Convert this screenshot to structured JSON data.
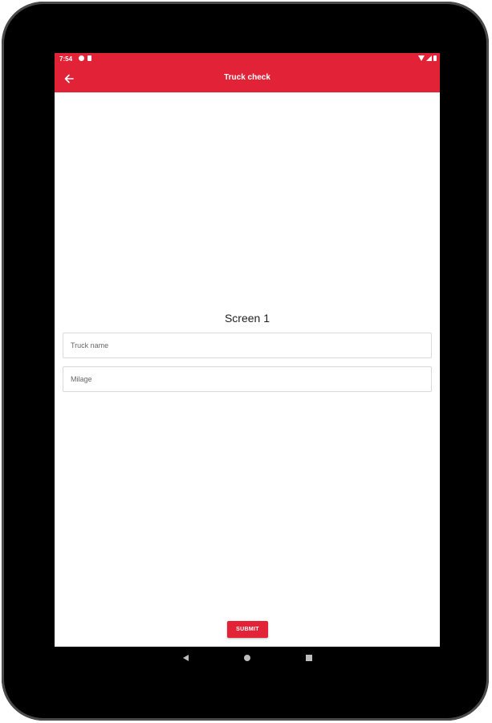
{
  "status_bar": {
    "time": "7:54",
    "icons_left": [
      "sync-icon",
      "sd-card-icon"
    ],
    "icons_right": [
      "wifi-icon",
      "signal-icon",
      "battery-icon"
    ]
  },
  "app_bar": {
    "title": "Truck check",
    "back_icon": "arrow-left-icon"
  },
  "main": {
    "title": "Screen 1",
    "truck_name": {
      "placeholder": "Truck name",
      "value": ""
    },
    "milage": {
      "placeholder": "Milage",
      "value": ""
    },
    "submit_label": "SUBMIT"
  },
  "nav_bar": {
    "icons": [
      "back-triangle-icon",
      "home-circle-icon",
      "recents-square-icon"
    ]
  },
  "colors": {
    "accent": "#e22337",
    "device_frame": "#000000"
  }
}
